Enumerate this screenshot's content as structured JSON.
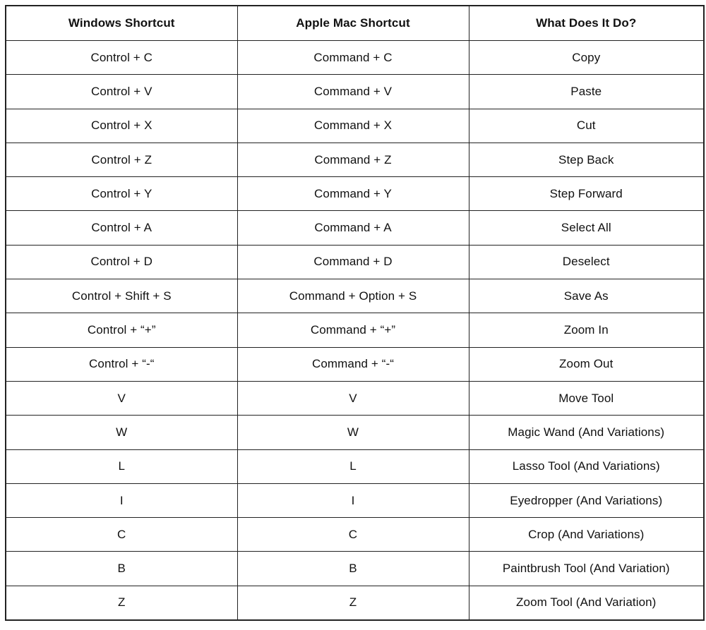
{
  "table": {
    "headers": [
      "Windows Shortcut",
      "Apple Mac Shortcut",
      "What Does It Do?"
    ],
    "rows": [
      [
        "Control + C",
        "Command + C",
        "Copy"
      ],
      [
        "Control + V",
        "Command + V",
        "Paste"
      ],
      [
        "Control + X",
        "Command + X",
        "Cut"
      ],
      [
        "Control + Z",
        "Command + Z",
        "Step Back"
      ],
      [
        "Control + Y",
        "Command + Y",
        "Step Forward"
      ],
      [
        "Control + A",
        "Command + A",
        "Select All"
      ],
      [
        "Control + D",
        "Command + D",
        "Deselect"
      ],
      [
        "Control + Shift + S",
        "Command + Option + S",
        "Save As"
      ],
      [
        "Control + “+”",
        "Command + “+”",
        "Zoom In"
      ],
      [
        "Control + “-“",
        "Command + “-“",
        "Zoom Out"
      ],
      [
        "V",
        "V",
        "Move Tool"
      ],
      [
        "W",
        "W",
        "Magic Wand (And Variations)"
      ],
      [
        "L",
        "L",
        "Lasso Tool (And Variations)"
      ],
      [
        "I",
        "I",
        "Eyedropper (And Variations)"
      ],
      [
        "C",
        "C",
        "Crop (And Variations)"
      ],
      [
        "B",
        "B",
        "Paintbrush Tool (And Variation)"
      ],
      [
        "Z",
        "Z",
        "Zoom Tool (And Variation)"
      ]
    ]
  }
}
